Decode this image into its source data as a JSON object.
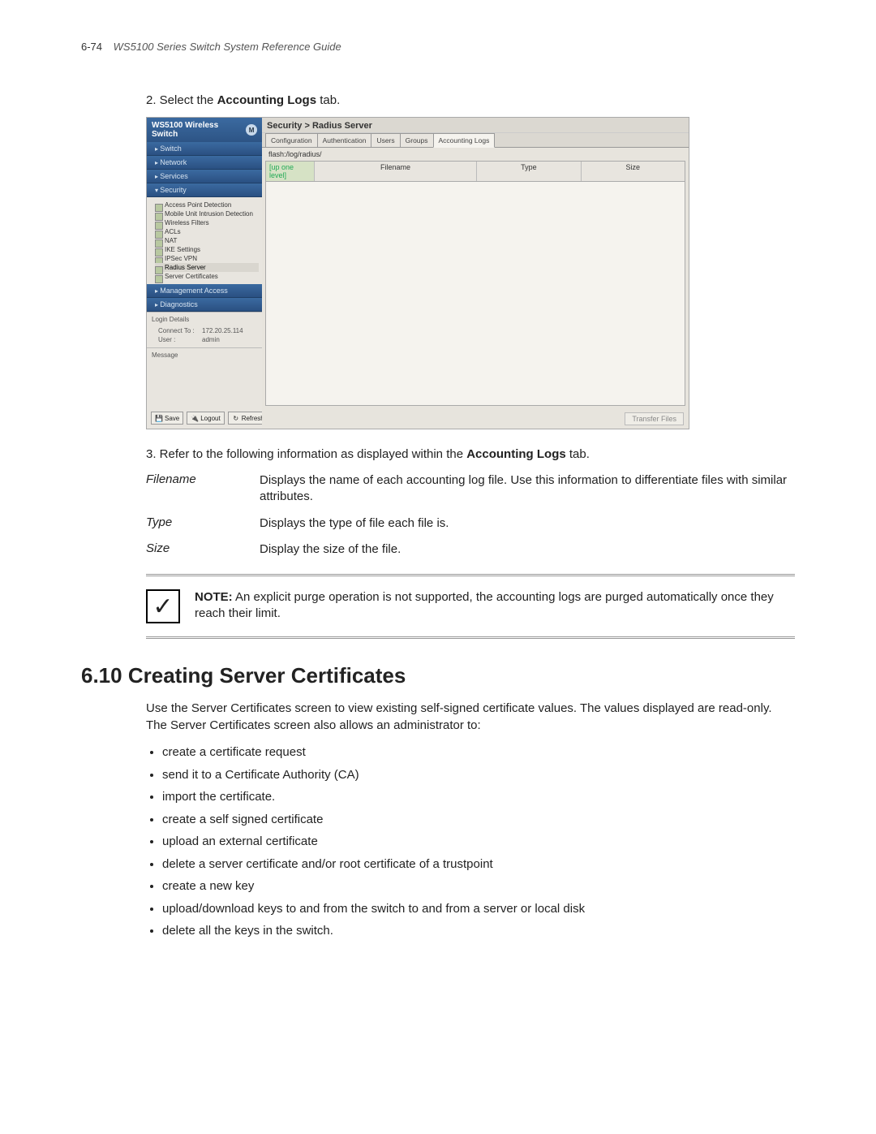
{
  "header": {
    "page_num": "6-74",
    "guide_title": "WS5100 Series Switch System Reference Guide"
  },
  "step2": {
    "prefix": "2. Select the ",
    "bold": "Accounting Logs",
    "suffix": " tab."
  },
  "screenshot": {
    "sidebar_title": "WS5100 Wireless Switch",
    "logo_text": "M",
    "nav": [
      "Switch",
      "Network",
      "Services",
      "Security"
    ],
    "nav_bottom": [
      "Management Access",
      "Diagnostics"
    ],
    "tree": [
      "Access Point Detection",
      "Mobile Unit Intrusion Detection",
      "Wireless Filters",
      "ACLs",
      "NAT",
      "IKE Settings",
      "IPSec VPN",
      "Radius Server",
      "Server Certificates"
    ],
    "login": {
      "title": "Login Details",
      "connect_lbl": "Connect To :",
      "connect_val": "172.20.25.114",
      "user_lbl": "User :",
      "user_val": "admin",
      "message_lbl": "Message"
    },
    "buttons": {
      "save": "Save",
      "logout": "Logout",
      "refresh": "Refresh"
    },
    "breadcrumb": "Security > Radius Server",
    "tabs": [
      "Configuration",
      "Authentication",
      "Users",
      "Groups",
      "Accounting Logs"
    ],
    "active_tab": 4,
    "path": "flash:/log/radius/",
    "up_link": "[up one level]",
    "columns": [
      "Filename",
      "Type",
      "Size"
    ],
    "transfer_btn": "Transfer Files"
  },
  "step3": {
    "prefix": "3. Refer to the following information as displayed within the ",
    "bold": "Accounting Logs",
    "suffix": " tab."
  },
  "defs": [
    {
      "term": "Filename",
      "desc": "Displays the name of each accounting log file. Use this information to differentiate files with similar attributes."
    },
    {
      "term": "Type",
      "desc": "Displays the type of file each file is."
    },
    {
      "term": "Size",
      "desc": "Display the size of the file."
    }
  ],
  "note": {
    "label": "NOTE:",
    "text": " An explicit purge operation is not supported, the accounting logs are purged automatically once they reach their limit."
  },
  "section": {
    "num": "6.10",
    "title": "Creating Server Certificates",
    "para_prefix": "Use the ",
    "para_bold": "Server Certificates",
    "para_suffix": " screen to view existing self-signed certificate values. The values displayed are read-only. The Server Certificates screen also allows an administrator to:",
    "bullets": [
      "create a certificate request",
      "send it to a Certificate Authority (CA)",
      "import the certificate.",
      "create a self signed certificate",
      "upload an external certificate",
      "delete a server certificate and/or root certificate of a trustpoint",
      "create a new key",
      "upload/download keys to and from the switch to and from a server or local disk",
      "delete all the keys in the switch."
    ]
  }
}
